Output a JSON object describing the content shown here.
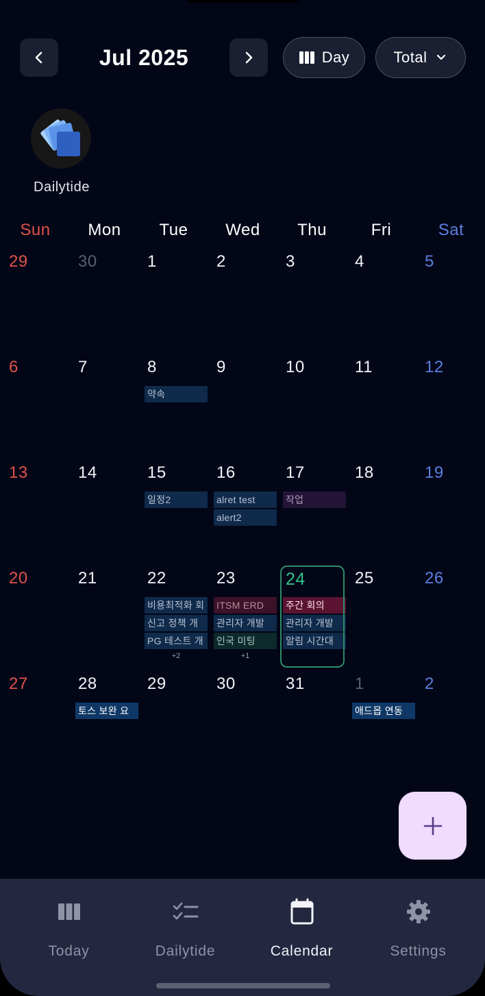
{
  "header": {
    "month_title": "Jul 2025",
    "view_label": "Day",
    "filter_label": "Total"
  },
  "app_chip": {
    "name": "Dailytide"
  },
  "weekdays": [
    "Sun",
    "Mon",
    "Tue",
    "Wed",
    "Thu",
    "Fri",
    "Sat"
  ],
  "weeks": [
    [
      {
        "n": "29",
        "other": true
      },
      {
        "n": "30",
        "other": true
      },
      {
        "n": "1"
      },
      {
        "n": "2"
      },
      {
        "n": "3"
      },
      {
        "n": "4"
      },
      {
        "n": "5"
      }
    ],
    [
      {
        "n": "6"
      },
      {
        "n": "7"
      },
      {
        "n": "8",
        "events": [
          {
            "t": "약속",
            "c": "navy"
          }
        ]
      },
      {
        "n": "9"
      },
      {
        "n": "10"
      },
      {
        "n": "11"
      },
      {
        "n": "12"
      }
    ],
    [
      {
        "n": "13"
      },
      {
        "n": "14"
      },
      {
        "n": "15",
        "events": [
          {
            "t": "일정2",
            "c": "navy"
          }
        ]
      },
      {
        "n": "16",
        "events": [
          {
            "t": "alret test",
            "c": "navy"
          },
          {
            "t": "alert2",
            "c": "navy"
          }
        ]
      },
      {
        "n": "17",
        "events": [
          {
            "t": "작업",
            "c": "purple"
          }
        ]
      },
      {
        "n": "18"
      },
      {
        "n": "19"
      }
    ],
    [
      {
        "n": "20"
      },
      {
        "n": "21"
      },
      {
        "n": "22",
        "events": [
          {
            "t": "비용최적화 회",
            "c": "navy"
          },
          {
            "t": "신고 정책 개",
            "c": "navy"
          },
          {
            "t": "PG 테스트 개",
            "c": "navy"
          }
        ],
        "more": "+2"
      },
      {
        "n": "23",
        "events": [
          {
            "t": "ITSM ERD",
            "c": "maroon"
          },
          {
            "t": "관리자 개발",
            "c": "navy"
          },
          {
            "t": "인국 미팅",
            "c": "teal"
          }
        ],
        "more": "+1"
      },
      {
        "n": "24",
        "today": true,
        "events": [
          {
            "t": "주간 회의",
            "c": "red"
          },
          {
            "t": "관리자 개발",
            "c": "navy"
          },
          {
            "t": "알림 시간대",
            "c": "navy"
          }
        ]
      },
      {
        "n": "25"
      },
      {
        "n": "26"
      }
    ],
    [
      {
        "n": "27"
      },
      {
        "n": "28",
        "events": [
          {
            "t": "토스 보완 요",
            "c": "blue"
          }
        ]
      },
      {
        "n": "29"
      },
      {
        "n": "30"
      },
      {
        "n": "31"
      },
      {
        "n": "1",
        "other": true,
        "events": [
          {
            "t": "애드몹 연동",
            "c": "blue"
          }
        ]
      },
      {
        "n": "2",
        "other": true
      }
    ]
  ],
  "fab": {
    "icon": "plus-icon"
  },
  "nav": [
    {
      "label": "Today",
      "icon": "columns-icon"
    },
    {
      "label": "Dailytide",
      "icon": "checklist-icon"
    },
    {
      "label": "Calendar",
      "icon": "calendar-icon",
      "active": true
    },
    {
      "label": "Settings",
      "icon": "gear-icon"
    }
  ],
  "colors": {
    "background": "#020617",
    "sunday": "#e0534a",
    "saturday": "#5b7fe0",
    "today": "#34c08a",
    "fab": "#efdcff",
    "nav_bg": "#232840"
  }
}
